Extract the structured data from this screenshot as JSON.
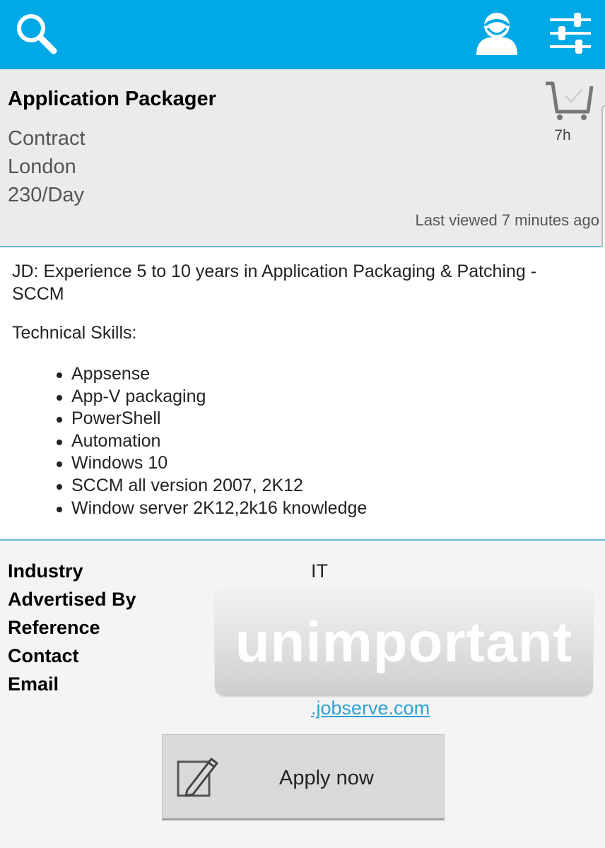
{
  "header": {
    "search_icon": "search-icon",
    "profile_icon": "user-profile-icon",
    "filter_icon": "filter-sliders-icon",
    "bar_color": "#00a9e6"
  },
  "job": {
    "title": "Application Packager",
    "type": "Contract",
    "location": "London",
    "rate": "230/Day",
    "age": "7h",
    "last_viewed": "Last viewed 7 minutes ago",
    "cart_icon": "shopping-cart-check-icon"
  },
  "description": {
    "jd": "JD: Experience 5 to 10 years in Application Packaging & Patching - SCCM",
    "skills_heading": "Technical Skills:",
    "skills": [
      "Appsense",
      "App-V packaging",
      "PowerShell",
      "Automation",
      "Windows 10",
      "SCCM all version 2007, 2K12",
      "Window server 2K12,2k16 knowledge"
    ]
  },
  "details": {
    "labels": {
      "industry": "Industry",
      "advertised_by": "Advertised By",
      "reference": "Reference",
      "contact": "Contact",
      "email": "Email"
    },
    "industry_value": "IT",
    "redaction_text": "unimportant",
    "email_value": ".jobserve.com"
  },
  "apply": {
    "label": "Apply now",
    "icon": "pen-edit-icon"
  },
  "colors": {
    "accent": "#00a9e6",
    "link": "#2ea1d3",
    "divider": "#62b7d9"
  }
}
